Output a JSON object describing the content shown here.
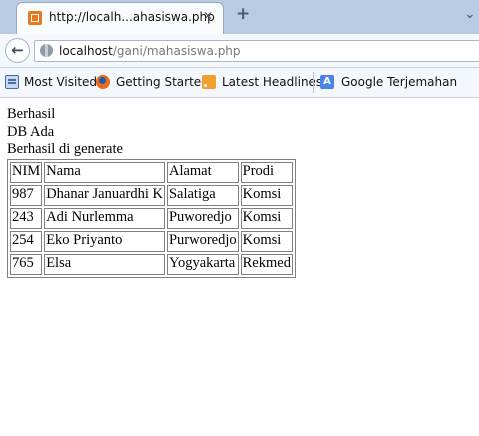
{
  "browser": {
    "tab": {
      "title": "http://localh...ahasiswa.php",
      "close_glyph": "✕",
      "favicon": "xampp-icon"
    },
    "new_tab_glyph": "+",
    "tab_scroll_glyph": "⌄",
    "back_glyph": "←",
    "url": {
      "host": "localhost",
      "path": "/gani/mahasiswa.php"
    },
    "bookmarks": [
      {
        "label": "Most Visited",
        "icon": "most-visited-icon"
      },
      {
        "label": "Getting Started",
        "icon": "firefox-icon"
      },
      {
        "label": "Latest Headlines",
        "icon": "rss-icon"
      },
      {
        "label": "Google Terjemahan",
        "icon": "translate-icon",
        "icon_glyph": "A"
      }
    ]
  },
  "page": {
    "messages": [
      "Berhasil",
      "DB Ada",
      "Berhasil di generate"
    ],
    "table": {
      "headers": [
        "NIM",
        "Nama",
        "Alamat",
        "Prodi"
      ],
      "rows": [
        [
          "987",
          "Dhanar Januardhi K",
          "Salatiga",
          "Komsi"
        ],
        [
          "243",
          "Adi Nurlemma",
          "Puworedjo",
          "Komsi"
        ],
        [
          "254",
          "Eko Priyanto",
          "Purworedjo",
          "Komsi"
        ],
        [
          "765",
          "Elsa",
          "Yogyakarta",
          "Rekmed"
        ]
      ]
    }
  }
}
